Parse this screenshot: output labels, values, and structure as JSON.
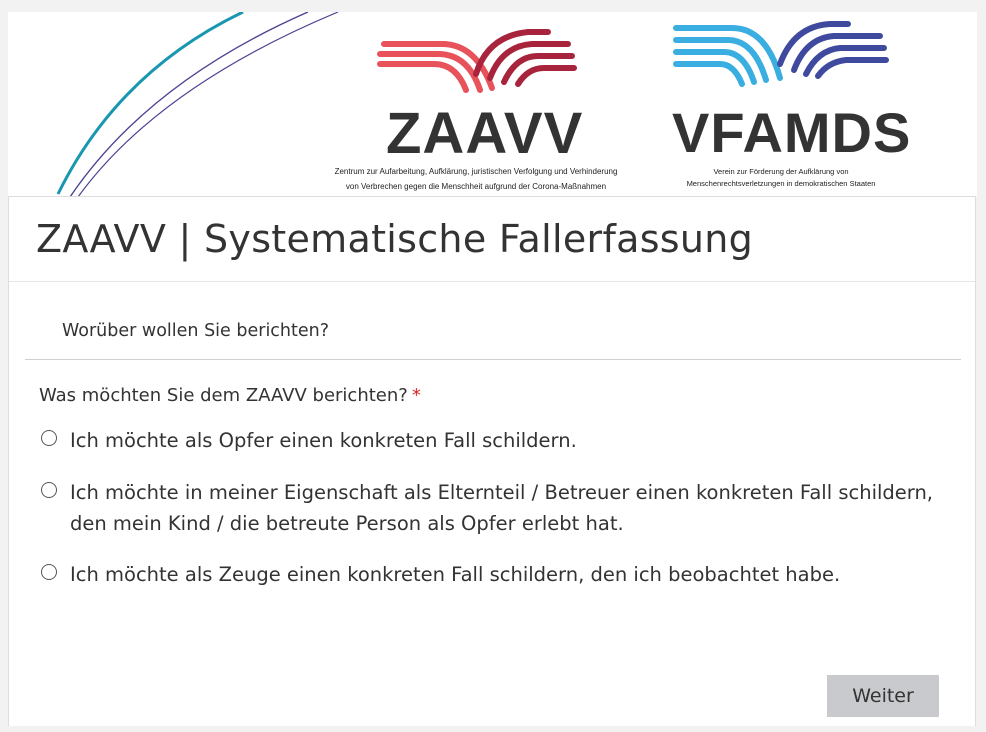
{
  "banner": {
    "zaavv_logo_text": "ZAAVV",
    "zaavv_subtitle_line1": "Zentrum zur Aufarbeitung, Aufklärung, juristischen Verfolgung und Verhinderung",
    "zaavv_subtitle_line2": "von Verbrechen gegen die Menschheit aufgrund der Corona-Maßnahmen",
    "vfamds_logo_text": "VFAMDS",
    "vfamds_subtitle_line1": "Verein zur Förderung der Aufklärung von",
    "vfamds_subtitle_line2": "Menschenrechtsverletzungen in demokratischen Staaten",
    "colors": {
      "zaavv_red": "#e8525a",
      "zaavv_dark_red": "#a8243c",
      "vfamds_blue": "#3aaee0",
      "vfamds_dark_blue": "#3f4a9e",
      "arc_teal": "#1a97b0",
      "arc_purple": "#4b4494"
    }
  },
  "form": {
    "title": "ZAAVV | Systematische Fallerfassung",
    "section_heading": "Worüber wollen Sie berichten?",
    "question": "Was möchten Sie dem ZAAVV berichten?",
    "required_marker": "*",
    "options": [
      "Ich möchte als Opfer einen konkreten Fall schildern.",
      "Ich möchte in meiner Eigenschaft als Elternteil / Betreuer einen konkreten Fall schildern, den mein Kind / die betreute Person als Opfer erlebt hat.",
      "Ich möchte als Zeuge einen konkreten Fall schildern, den ich beobachtet habe."
    ],
    "next_button_label": "Weiter"
  }
}
